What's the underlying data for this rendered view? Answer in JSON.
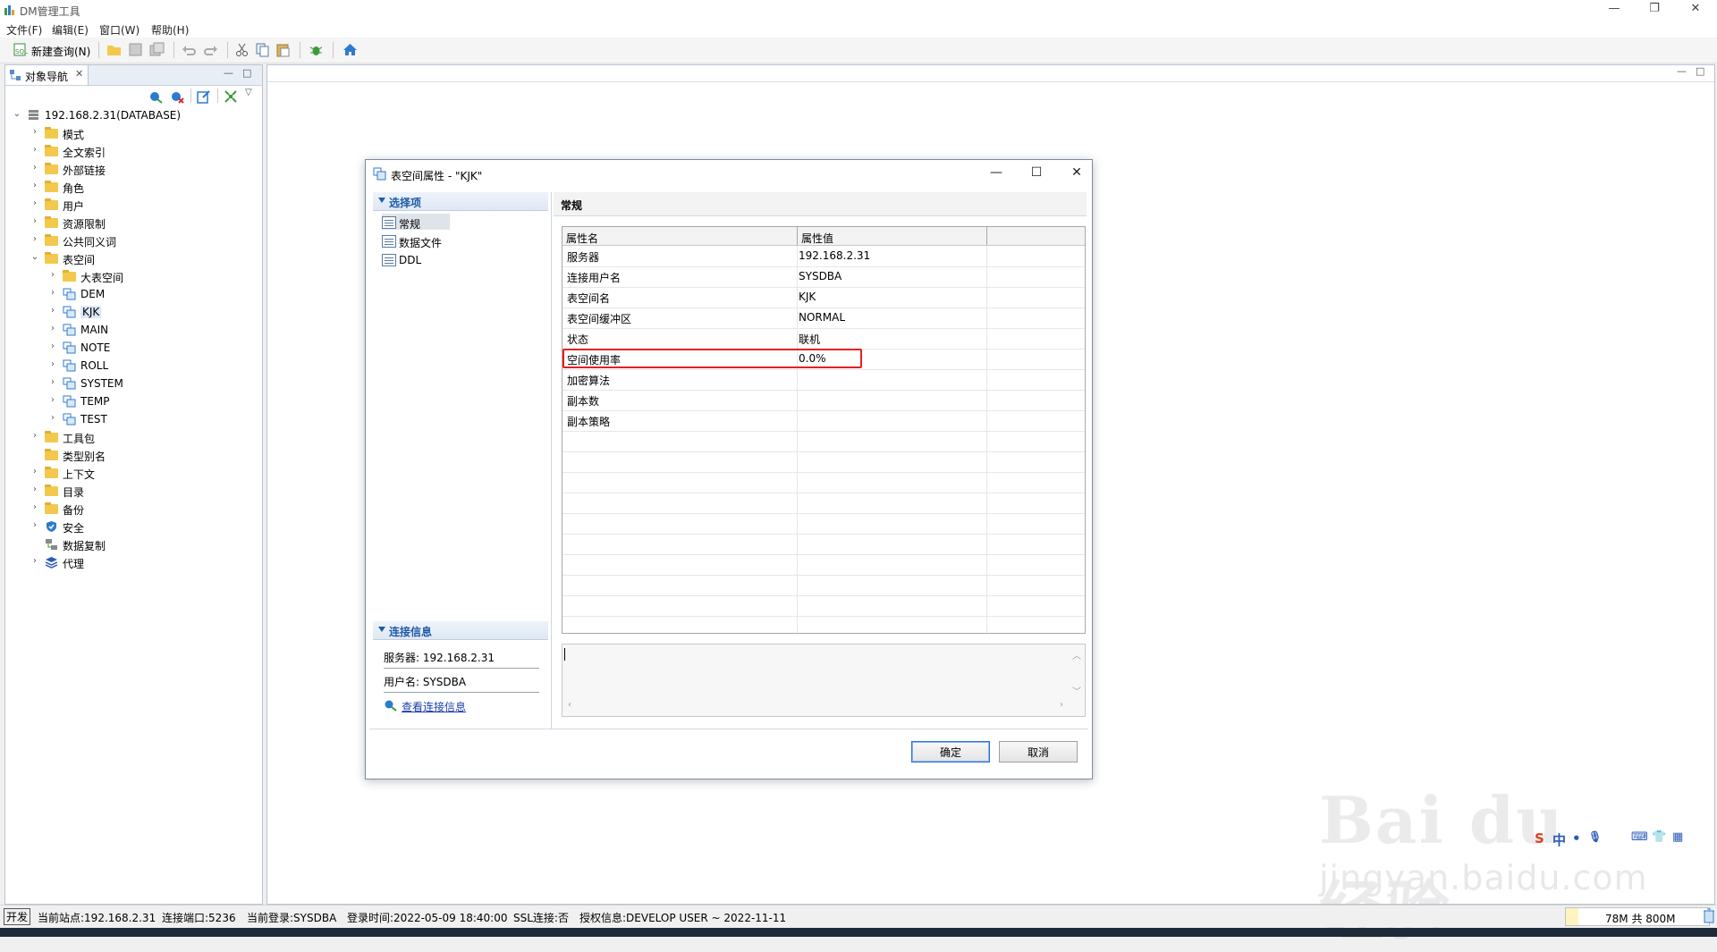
{
  "app": {
    "title": "DM管理工具"
  },
  "menu": [
    "文件(F)",
    "编辑(E)",
    "窗口(W)",
    "帮助(H)"
  ],
  "toolbar": {
    "new_query": "新建查询(N)"
  },
  "nav": {
    "tab_label": "对象导航",
    "root": "192.168.2.31(DATABASE)",
    "items": [
      "模式",
      "全文索引",
      "外部链接",
      "角色",
      "用户",
      "资源限制",
      "公共同义词",
      "表空间"
    ],
    "tablespaces": [
      "大表空间",
      "DEM",
      "KJK",
      "MAIN",
      "NOTE",
      "ROLL",
      "SYSTEM",
      "TEMP",
      "TEST"
    ],
    "after": [
      "工具包",
      "类型别名",
      "上下文",
      "目录",
      "备份",
      "安全",
      "数据复制",
      "代理"
    ]
  },
  "dialog": {
    "title": "表空间属性 - \"KJK\"",
    "options_header": "选择项",
    "options": [
      "常规",
      "数据文件",
      "DDL"
    ],
    "conn_header": "连接信息",
    "conn_server": "服务器: 192.168.2.31",
    "conn_user": "用户名: SYSDBA",
    "conn_link": "查看连接信息",
    "section_title": "常规",
    "col_name": "属性名",
    "col_value": "属性值",
    "rows": [
      {
        "k": "服务器",
        "v": "192.168.2.31"
      },
      {
        "k": "连接用户名",
        "v": "SYSDBA"
      },
      {
        "k": "表空间名",
        "v": "KJK"
      },
      {
        "k": "表空间缓冲区",
        "v": "NORMAL"
      },
      {
        "k": "状态",
        "v": "联机"
      },
      {
        "k": "空间使用率",
        "v": "0.0%"
      },
      {
        "k": "加密算法",
        "v": ""
      },
      {
        "k": "副本数",
        "v": ""
      },
      {
        "k": "副本策略",
        "v": ""
      }
    ],
    "ok": "确定",
    "cancel": "取消"
  },
  "status": {
    "mode": "开发",
    "site": "当前站点:192.168.2.31",
    "port": "连接端口:5236",
    "login": "当前登录:SYSDBA",
    "time": "登录时间:2022-05-09 18:40:00",
    "ssl": "SSL连接:否",
    "license": "授权信息:DEVELOP USER ~ 2022-11-11",
    "memory": "78M 共 800M"
  },
  "watermark": {
    "brand": "Bai du 经验",
    "url": "jingyan.baidu.com"
  },
  "ime": {
    "chars": [
      "中",
      "•",
      "🎙",
      "⌨",
      "👕",
      "▦"
    ]
  },
  "colors": {
    "accent": "#1e5aa8",
    "highlight": "#e52020",
    "folder": "#f2c94c"
  }
}
